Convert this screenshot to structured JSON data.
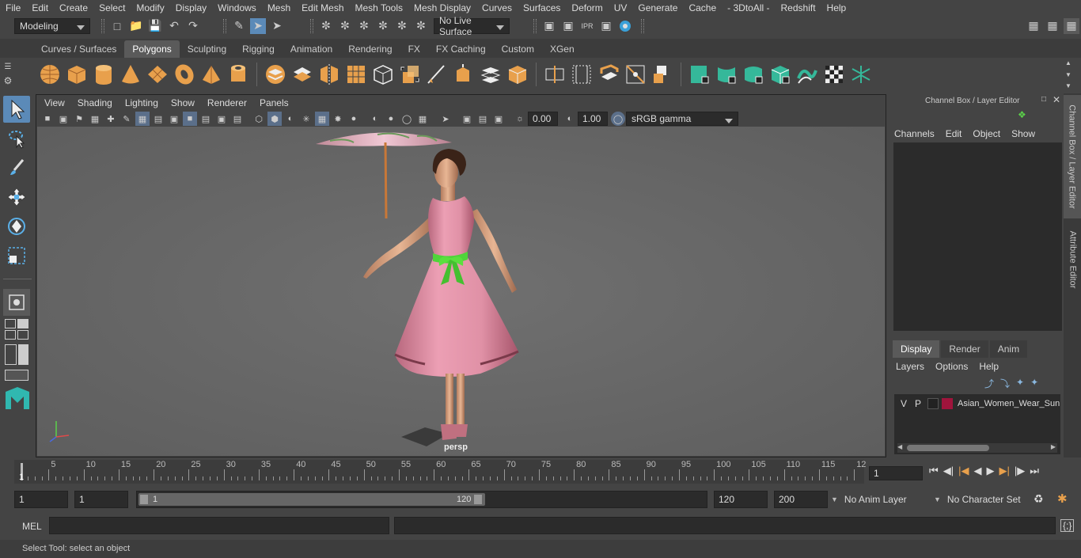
{
  "menu": [
    "File",
    "Edit",
    "Create",
    "Select",
    "Modify",
    "Display",
    "Windows",
    "Mesh",
    "Edit Mesh",
    "Mesh Tools",
    "Mesh Display",
    "Curves",
    "Surfaces",
    "Deform",
    "UV",
    "Generate",
    "Cache",
    "- 3DtoAll -",
    "Redshift",
    "Help"
  ],
  "status": {
    "mode": "Modeling",
    "live_surface": "No Live Surface"
  },
  "shelf_tabs": [
    "Curves / Surfaces",
    "Polygons",
    "Sculpting",
    "Rigging",
    "Animation",
    "Rendering",
    "FX",
    "FX Caching",
    "Custom",
    "XGen"
  ],
  "active_shelf_tab": "Polygons",
  "viewport": {
    "menu": [
      "View",
      "Shading",
      "Lighting",
      "Show",
      "Renderer",
      "Panels"
    ],
    "exposure": "0.00",
    "gamma": "1.00",
    "color_space": "sRGB gamma",
    "camera_label": "persp"
  },
  "channel_box": {
    "title": "Channel Box / Layer Editor",
    "menu": [
      "Channels",
      "Edit",
      "Object",
      "Show"
    ]
  },
  "layer_editor": {
    "tabs": [
      "Display",
      "Render",
      "Anim"
    ],
    "active_tab": "Display",
    "menu": [
      "Layers",
      "Options",
      "Help"
    ],
    "layers": [
      {
        "v": "V",
        "p": "P",
        "color": "#a0143c",
        "name": "Asian_Women_Wear_Sun"
      }
    ]
  },
  "side_tabs": [
    "Channel Box / Layer Editor",
    "Attribute Editor"
  ],
  "timeline": {
    "ticks": [
      "5",
      "10",
      "15",
      "20",
      "25",
      "30",
      "35",
      "40",
      "45",
      "50",
      "55",
      "60",
      "65",
      "70",
      "75",
      "80",
      "85",
      "90",
      "95",
      "100",
      "105",
      "110",
      "115",
      "12"
    ],
    "start_marker": "1",
    "current_frame": "1"
  },
  "range": {
    "start": "1",
    "playback_start": "1",
    "slider_start": "1",
    "slider_end": "120",
    "playback_end": "120",
    "end": "200",
    "anim_layer": "No Anim Layer",
    "character_set": "No Character Set"
  },
  "command": {
    "label": "MEL"
  },
  "help_line": "Select Tool: select an object",
  "colors": {
    "accent": "#5b8ab8",
    "shelf_orange": "#e8a04c",
    "shelf_green": "#35b89a",
    "dress_pink": "#e49aae",
    "sash_green": "#4fd43a"
  }
}
